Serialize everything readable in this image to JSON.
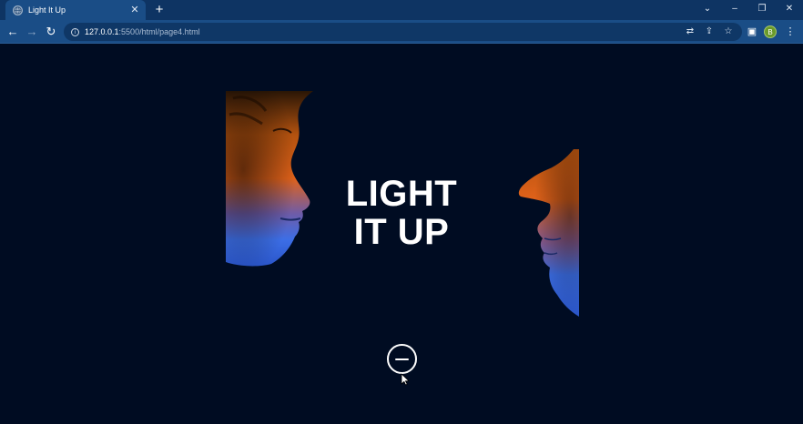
{
  "browser": {
    "tab": {
      "title": "Light It Up",
      "favicon": "globe-icon",
      "close_glyph": "✕"
    },
    "new_tab_glyph": "+",
    "window_controls": {
      "tab_search_glyph": "⌄",
      "minimize_glyph": "–",
      "restore_glyph": "❐",
      "close_glyph": "✕"
    },
    "toolbar": {
      "back_glyph": "←",
      "forward_glyph": "→",
      "reload_glyph": "↻",
      "url_host": "127.0.0.1",
      "url_rest": ":5500/html/page4.html",
      "translate_glyph": "⇄",
      "share_glyph": "⇪",
      "bookmark_glyph": "☆",
      "side_panel_glyph": "▣",
      "profile_initial": "B",
      "menu_glyph": "⋮"
    }
  },
  "page": {
    "headline_line1": "LIGHT",
    "headline_line2": "IT UP",
    "toggle_button": "minus-circle-icon",
    "colors": {
      "background": "#000c22",
      "accent_warm": "#e0621a",
      "accent_cool": "#3c6ee6"
    }
  }
}
